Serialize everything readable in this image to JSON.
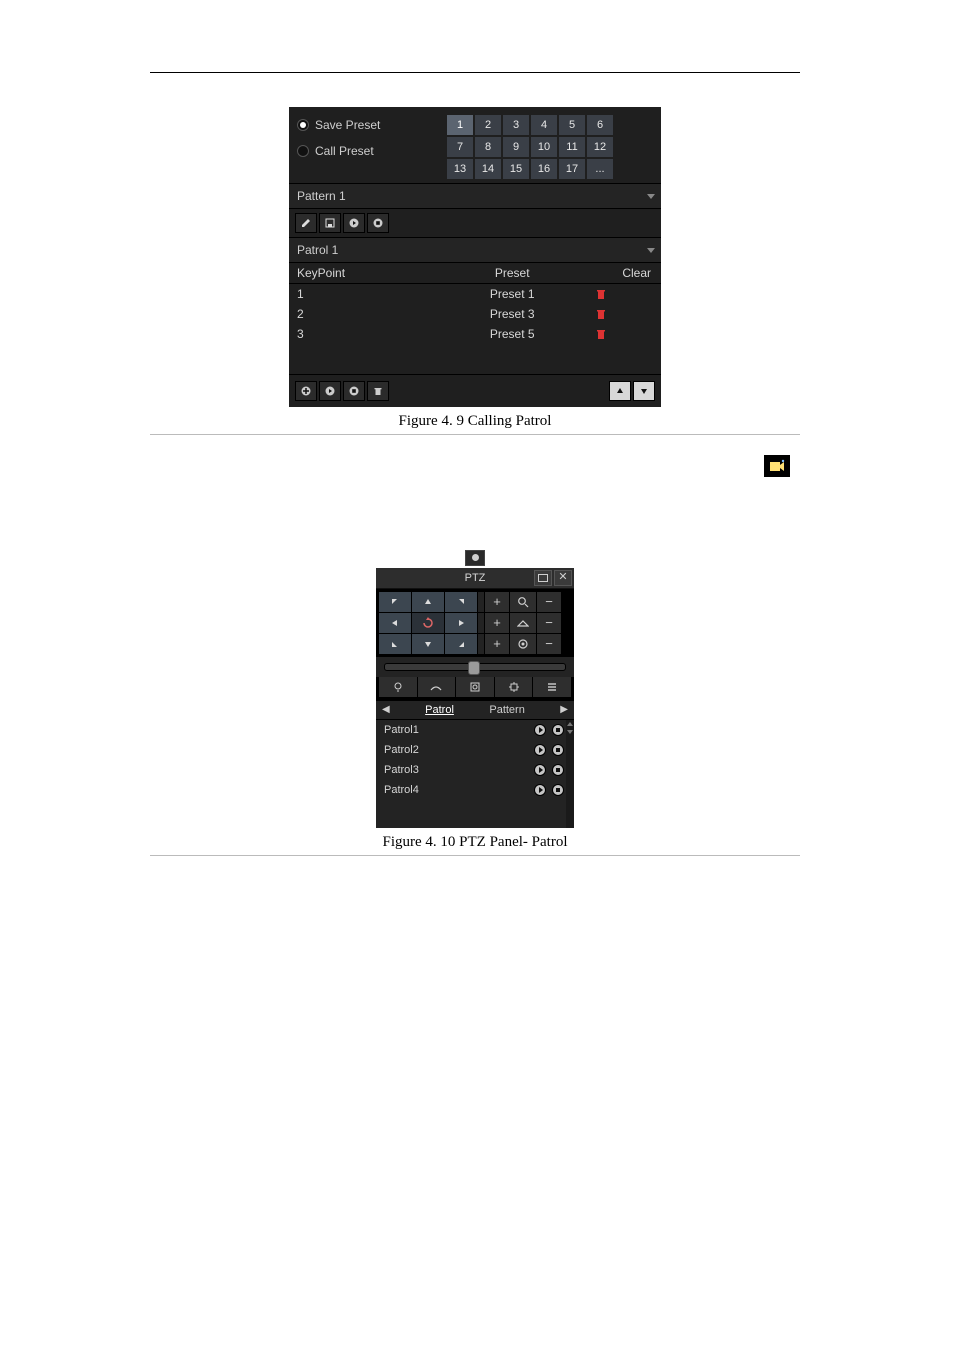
{
  "fig49": {
    "radios": {
      "save": "Save Preset",
      "call": "Call Preset",
      "selected": "save"
    },
    "presetNums": [
      "1",
      "2",
      "3",
      "4",
      "5",
      "6",
      "7",
      "8",
      "9",
      "10",
      "11",
      "12",
      "13",
      "14",
      "15",
      "16",
      "17",
      "..."
    ],
    "pattern": "Pattern 1",
    "patrol": "Patrol 1",
    "table": {
      "headers": {
        "key": "KeyPoint",
        "preset": "Preset",
        "clear": "Clear"
      },
      "rows": [
        {
          "key": "1",
          "preset": "Preset 1"
        },
        {
          "key": "2",
          "preset": "Preset 3"
        },
        {
          "key": "3",
          "preset": "Preset 5"
        }
      ]
    }
  },
  "caption49": {
    "title": "Figure 4. 9",
    "text": "Calling Patrol"
  },
  "caption410": {
    "title": "Figure 4. 10",
    "text": "PTZ Panel- Patrol"
  },
  "ptz": {
    "title": "PTZ",
    "tabs": {
      "patrol": "Patrol",
      "pattern": "Pattern"
    },
    "rows": [
      "Patrol1",
      "Patrol2",
      "Patrol3",
      "Patrol4"
    ]
  }
}
